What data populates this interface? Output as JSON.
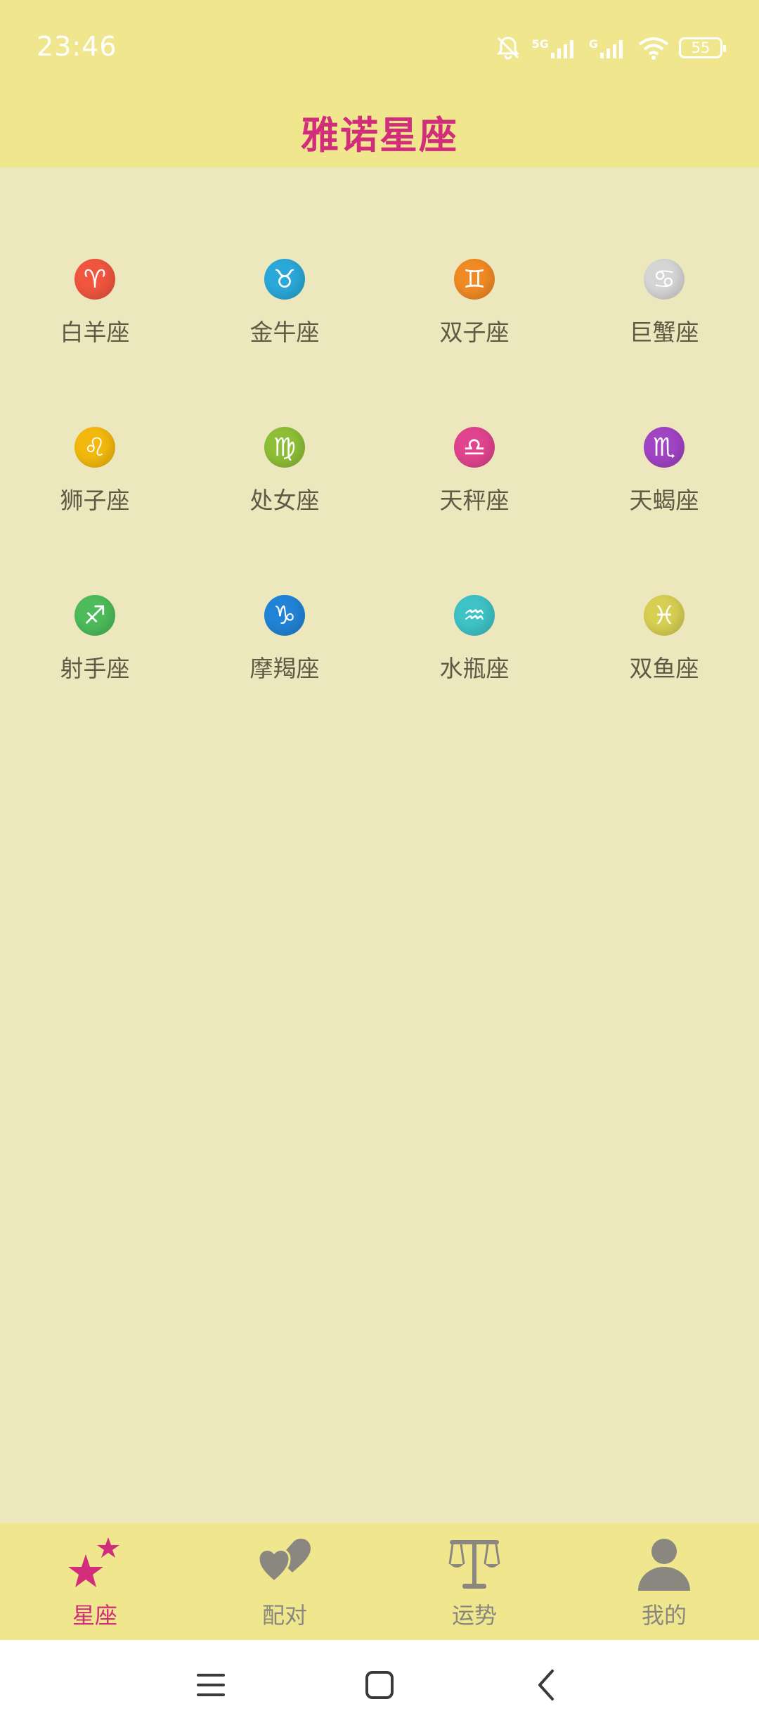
{
  "status_bar": {
    "time": "23:46",
    "network_labels": [
      "5G",
      "G"
    ],
    "battery_level": "55"
  },
  "app_bar": {
    "title": "雅诺星座"
  },
  "signs": [
    {
      "label": "白羊座",
      "glyph": "♈",
      "color": "#F0553F"
    },
    {
      "label": "金牛座",
      "glyph": "♉",
      "color": "#2AA8D8"
    },
    {
      "label": "双子座",
      "glyph": "♊",
      "color": "#F08A24"
    },
    {
      "label": "巨蟹座",
      "glyph": "♋",
      "color": "#D5D5D5"
    },
    {
      "label": "狮子座",
      "glyph": "♌",
      "color": "#F2B80E"
    },
    {
      "label": "处女座",
      "glyph": "♍",
      "color": "#8DBE36"
    },
    {
      "label": "天秤座",
      "glyph": "♎",
      "color": "#E0448E"
    },
    {
      "label": "天蝎座",
      "glyph": "♏",
      "color": "#A044C4"
    },
    {
      "label": "射手座",
      "glyph": "♐",
      "color": "#4DBB5A"
    },
    {
      "label": "摩羯座",
      "glyph": "♑",
      "color": "#2183D6"
    },
    {
      "label": "水瓶座",
      "glyph": "♒",
      "color": "#3EC2C6"
    },
    {
      "label": "双鱼座",
      "glyph": "♓",
      "color": "#D7CF52"
    }
  ],
  "bottom_nav": {
    "active_color": "#D12D7B",
    "inactive_color": "#8A8780",
    "items": [
      {
        "label": "星座",
        "icon": "stars-icon",
        "active": true
      },
      {
        "label": "配对",
        "icon": "hearts-icon",
        "active": false
      },
      {
        "label": "运势",
        "icon": "scales-icon",
        "active": false
      },
      {
        "label": "我的",
        "icon": "person-icon",
        "active": false
      }
    ]
  },
  "system_nav": {
    "icons": [
      "menu-icon",
      "home-icon",
      "back-icon"
    ]
  }
}
